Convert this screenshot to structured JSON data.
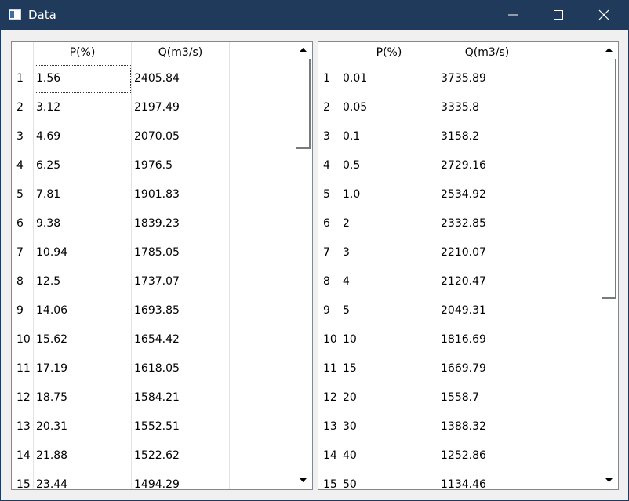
{
  "window": {
    "title": "Data"
  },
  "left_table": {
    "headers": [
      "P(%)",
      "Q(m3/s)"
    ],
    "rows": [
      {
        "n": "1",
        "p": "1.56",
        "q": "2405.84"
      },
      {
        "n": "2",
        "p": "3.12",
        "q": "2197.49"
      },
      {
        "n": "3",
        "p": "4.69",
        "q": "2070.05"
      },
      {
        "n": "4",
        "p": "6.25",
        "q": "1976.5"
      },
      {
        "n": "5",
        "p": "7.81",
        "q": "1901.83"
      },
      {
        "n": "6",
        "p": "9.38",
        "q": "1839.23"
      },
      {
        "n": "7",
        "p": "10.94",
        "q": "1785.05"
      },
      {
        "n": "8",
        "p": "12.5",
        "q": "1737.07"
      },
      {
        "n": "9",
        "p": "14.06",
        "q": "1693.85"
      },
      {
        "n": "10",
        "p": "15.62",
        "q": "1654.42"
      },
      {
        "n": "11",
        "p": "17.19",
        "q": "1618.05"
      },
      {
        "n": "12",
        "p": "18.75",
        "q": "1584.21"
      },
      {
        "n": "13",
        "p": "20.31",
        "q": "1552.51"
      },
      {
        "n": "14",
        "p": "21.88",
        "q": "1522.62"
      },
      {
        "n": "15",
        "p": "23.44",
        "q": "1494.29"
      }
    ]
  },
  "right_table": {
    "headers": [
      "P(%)",
      "Q(m3/s)"
    ],
    "rows": [
      {
        "n": "1",
        "p": "0.01",
        "q": "3735.89"
      },
      {
        "n": "2",
        "p": "0.05",
        "q": "3335.8"
      },
      {
        "n": "3",
        "p": "0.1",
        "q": "3158.2"
      },
      {
        "n": "4",
        "p": "0.5",
        "q": "2729.16"
      },
      {
        "n": "5",
        "p": "1.0",
        "q": "2534.92"
      },
      {
        "n": "6",
        "p": "2",
        "q": "2332.85"
      },
      {
        "n": "7",
        "p": "3",
        "q": "2210.07"
      },
      {
        "n": "8",
        "p": "4",
        "q": "2120.47"
      },
      {
        "n": "9",
        "p": "5",
        "q": "2049.31"
      },
      {
        "n": "10",
        "p": "10",
        "q": "1816.69"
      },
      {
        "n": "11",
        "p": "15",
        "q": "1669.79"
      },
      {
        "n": "12",
        "p": "20",
        "q": "1558.7"
      },
      {
        "n": "13",
        "p": "30",
        "q": "1388.32"
      },
      {
        "n": "14",
        "p": "40",
        "q": "1252.86"
      },
      {
        "n": "15",
        "p": "50",
        "q": "1134.46"
      }
    ]
  },
  "colors": {
    "titlebar": "#1f3a5a",
    "window_bg": "#f0f0f0",
    "grid_line": "#e3e3e3"
  }
}
